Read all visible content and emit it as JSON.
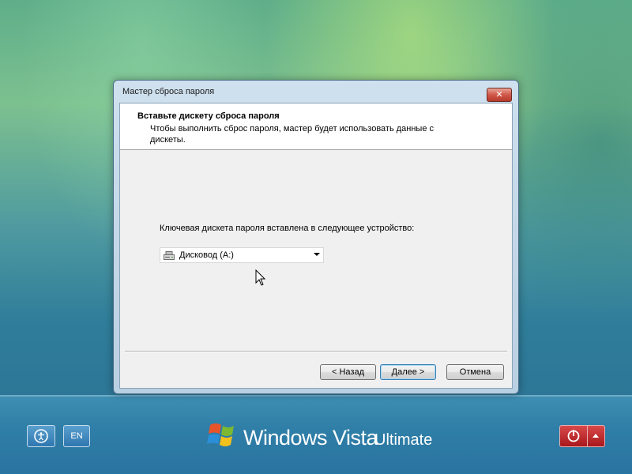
{
  "window": {
    "title": "Мастер сброса пароля",
    "close_label": "✕"
  },
  "wizard": {
    "header_title": "Вставьте дискету сброса пароля",
    "header_description": "Чтобы выполнить сброс пароля, мастер будет использовать данные с дискеты.",
    "device_label": "Ключевая дискета пароля вставлена в следующее устройство:",
    "device_select": {
      "value": "Дисковод (A:)",
      "icon": "floppy-drive-icon"
    }
  },
  "buttons": {
    "back": "< Назад",
    "next": "Далее >",
    "cancel": "Отмена"
  },
  "taskbar": {
    "ease_of_access_icon": "ease-of-access-icon",
    "language": "EN",
    "power_icon": "power-icon"
  },
  "branding": {
    "product": "Windows Vista",
    "edition": "Ultimate"
  },
  "colors": {
    "close_button": "#c84a3c",
    "power_button": "#b5202a",
    "desktop_band": "#2f7fa8"
  }
}
